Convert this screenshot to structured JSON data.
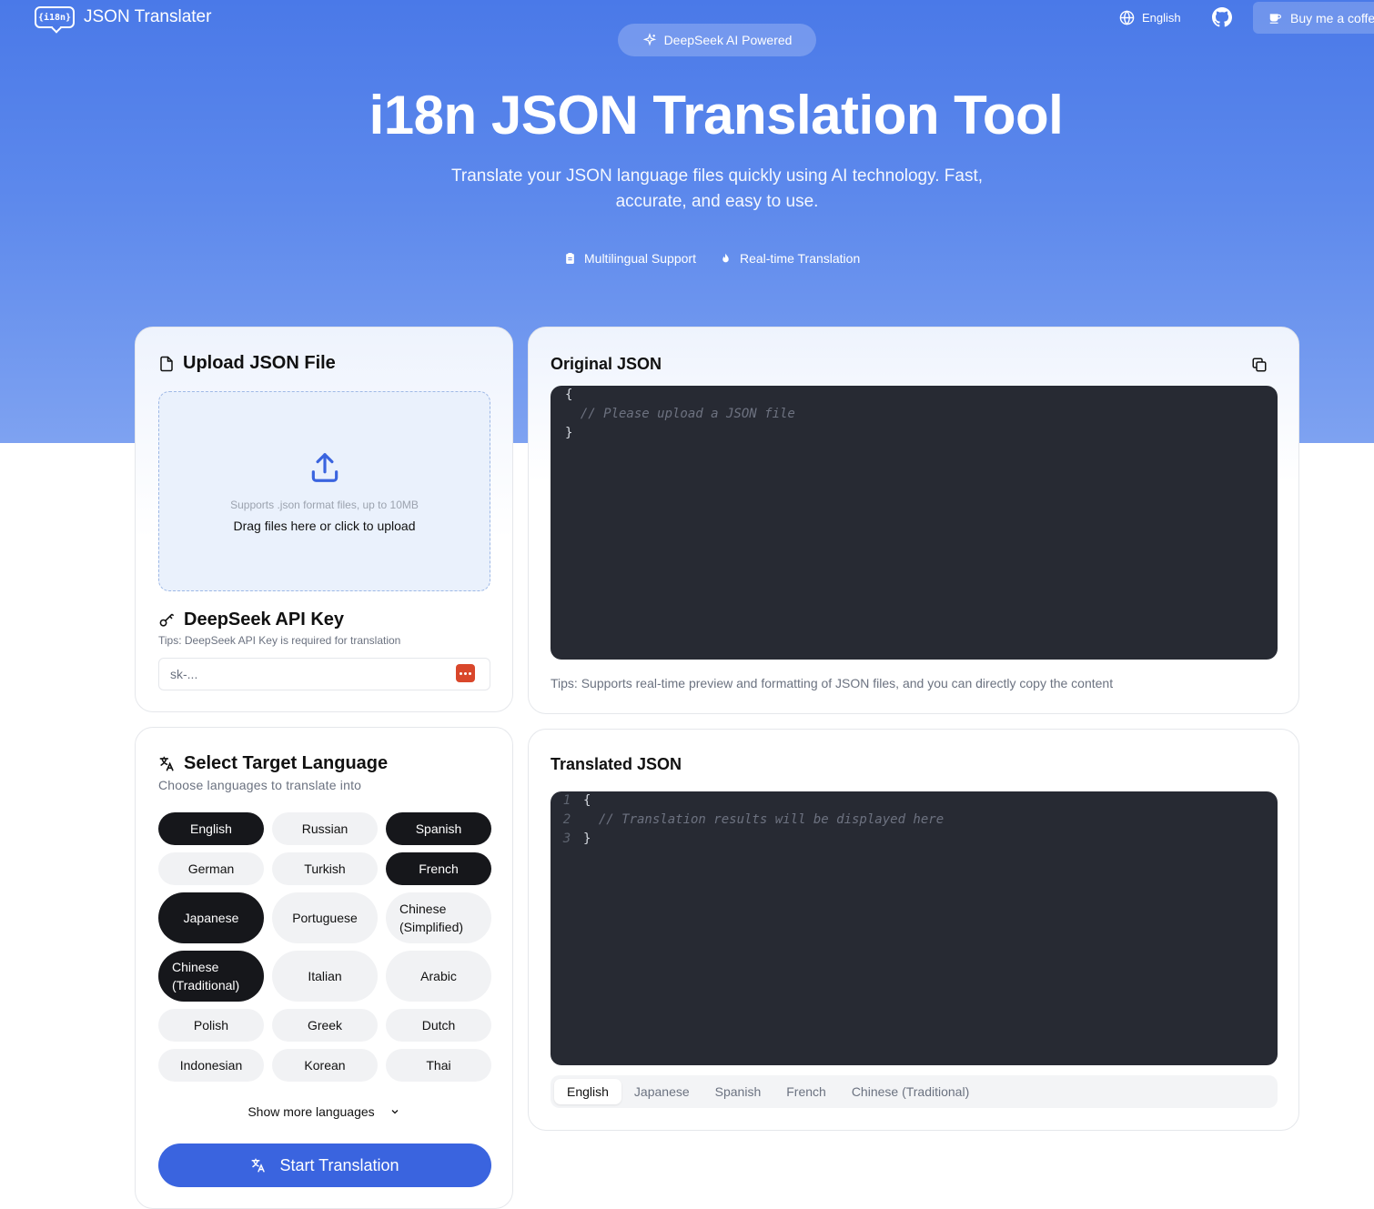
{
  "header": {
    "logo_badge": "{i18n}",
    "logo_text": "JSON Translater",
    "language": "English",
    "github_icon": "github-icon",
    "coffee_label": "Buy me a coffee"
  },
  "hero": {
    "badge": "DeepSeek AI Powered",
    "title": "i18n JSON Translation Tool",
    "subtitle": "Translate your JSON language files quickly using AI technology. Fast, accurate, and easy to use.",
    "features": [
      {
        "icon": "clipboard-icon",
        "label": "Multilingual Support"
      },
      {
        "icon": "flame-icon",
        "label": "Real-time Translation"
      }
    ]
  },
  "upload": {
    "title": "Upload JSON File",
    "support_text": "Supports .json format files, up to 10MB",
    "drop_text": "Drag files here or click to upload"
  },
  "api_key": {
    "title": "DeepSeek API Key",
    "tip": "Tips: DeepSeek API Key is required for translation",
    "placeholder": "sk-..."
  },
  "original": {
    "title": "Original JSON",
    "code": [
      "{",
      "  // Please upload a JSON file",
      "}"
    ],
    "tip": "Tips: Supports real-time preview and formatting of JSON files, and you can directly copy the content"
  },
  "languages": {
    "title": "Select Target Language",
    "subtitle": "Choose languages to translate into",
    "items": [
      {
        "label": "English",
        "selected": true
      },
      {
        "label": "Russian",
        "selected": false
      },
      {
        "label": "Spanish",
        "selected": true
      },
      {
        "label": "German",
        "selected": false
      },
      {
        "label": "Turkish",
        "selected": false
      },
      {
        "label": "French",
        "selected": true
      },
      {
        "label": "Japanese",
        "selected": true
      },
      {
        "label": "Portuguese",
        "selected": false
      },
      {
        "label": "Chinese (Simplified)",
        "selected": false
      },
      {
        "label": "Chinese (Traditional)",
        "selected": true
      },
      {
        "label": "Italian",
        "selected": false
      },
      {
        "label": "Arabic",
        "selected": false
      },
      {
        "label": "Polish",
        "selected": false
      },
      {
        "label": "Greek",
        "selected": false
      },
      {
        "label": "Dutch",
        "selected": false
      },
      {
        "label": "Indonesian",
        "selected": false
      },
      {
        "label": "Korean",
        "selected": false
      },
      {
        "label": "Thai",
        "selected": false
      }
    ],
    "show_more": "Show more languages",
    "start_button": "Start Translation"
  },
  "translated": {
    "title": "Translated JSON",
    "lines": [
      {
        "n": "1",
        "text": "{"
      },
      {
        "n": "2",
        "text": "  // Translation results will be displayed here"
      },
      {
        "n": "3",
        "text": "}"
      }
    ],
    "tabs": [
      "English",
      "Japanese",
      "Spanish",
      "French",
      "Chinese (Traditional)"
    ],
    "active_tab": "English"
  },
  "colors": {
    "hero_gradient_top": "#4a79e8",
    "accent": "#3a64df",
    "editor_bg": "#272a33",
    "selected_chip": "#16171b"
  }
}
